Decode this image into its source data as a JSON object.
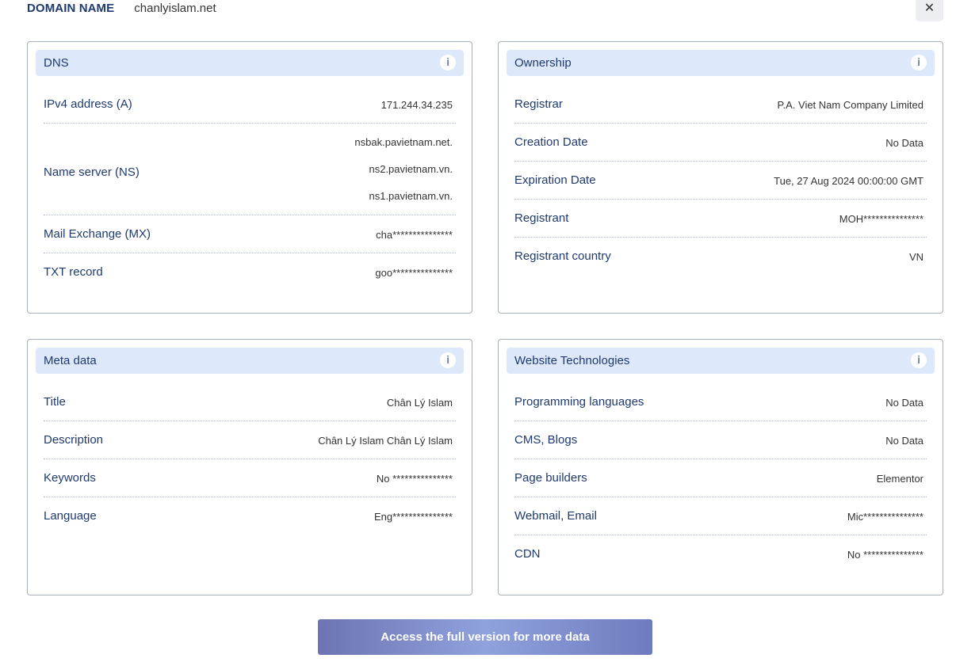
{
  "header": {
    "domain_label": "DOMAIN NAME",
    "domain_value": "chanlyislam.net",
    "close_glyph": "✕"
  },
  "dns": {
    "title": "DNS",
    "info": "i",
    "ipv4_label": "IPv4 address (A)",
    "ipv4_value": "171.244.34.235",
    "ns_label": "Name server (NS)",
    "ns_values": [
      "nsbak.pavietnam.net.",
      "ns2.pavietnam.vn.",
      "ns1.pavietnam.vn."
    ],
    "mx_label": "Mail Exchange (MX)",
    "mx_value": "cha***************",
    "txt_label": "TXT record",
    "txt_value": "goo***************"
  },
  "ownership": {
    "title": "Ownership",
    "info": "i",
    "rows": [
      {
        "label": "Registrar",
        "value": "P.A. Viet Nam Company Limited"
      },
      {
        "label": "Creation Date",
        "value": "No Data"
      },
      {
        "label": "Expiration Date",
        "value": "Tue, 27 Aug 2024 00:00:00 GMT"
      },
      {
        "label": "Registrant",
        "value": "MOH***************"
      },
      {
        "label": "Registrant country",
        "value": "VN"
      }
    ]
  },
  "meta": {
    "title": "Meta data",
    "info": "i",
    "rows": [
      {
        "label": "Title",
        "value": "Chân Lý Islam"
      },
      {
        "label": "Description",
        "value": "Chân Lý Islam Chân Lý Islam"
      },
      {
        "label": "Keywords",
        "value": "No ***************"
      },
      {
        "label": "Language",
        "value": "Eng***************"
      }
    ]
  },
  "tech": {
    "title": "Website Technologies",
    "info": "i",
    "rows": [
      {
        "label": "Programming languages",
        "value": "No Data"
      },
      {
        "label": "CMS, Blogs",
        "value": "No Data"
      },
      {
        "label": "Page builders",
        "value": "Elementor"
      },
      {
        "label": "Webmail, Email",
        "value": "Mic***************"
      },
      {
        "label": "CDN",
        "value": "No ***************"
      }
    ]
  },
  "cta": {
    "label": "Access the full version for more data"
  }
}
